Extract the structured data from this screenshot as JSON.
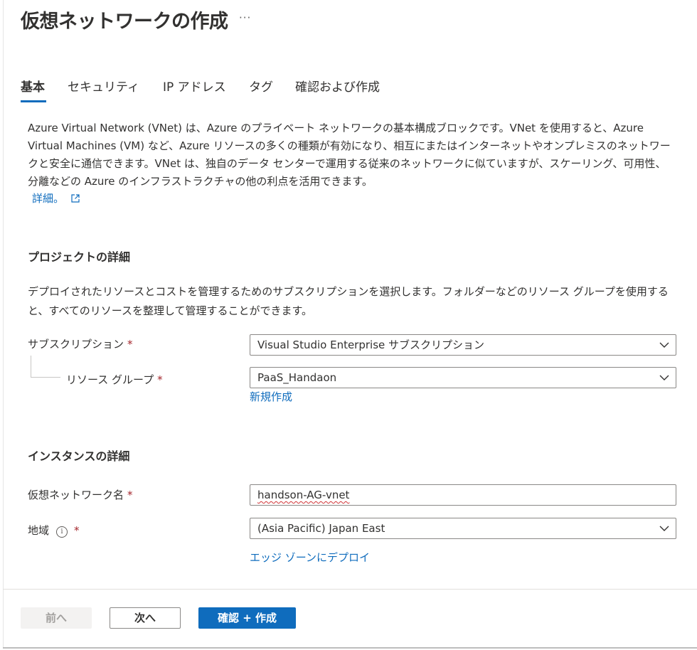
{
  "header": {
    "title": "仮想ネットワークの作成",
    "more_label": "···"
  },
  "tabs": [
    {
      "label": "基本",
      "active": true
    },
    {
      "label": "セキュリティ",
      "active": false
    },
    {
      "label": "IP アドレス",
      "active": false
    },
    {
      "label": "タグ",
      "active": false
    },
    {
      "label": "確認および作成",
      "active": false
    }
  ],
  "intro": {
    "text": "Azure Virtual Network (VNet) は、Azure のプライベート ネットワークの基本構成ブロックです。VNet を使用すると、Azure Virtual Machines (VM) など、Azure リソースの多くの種類が有効になり、相互にまたはインターネットやオンプレミスのネットワークと安全に通信できます。VNet は、独自のデータ センターで運用する従来のネットワークに似ていますが、スケーリング、可用性、分離などの Azure のインフラストラクチャの他の利点を活用できます。",
    "learn_more": "詳細。"
  },
  "project": {
    "title": "プロジェクトの詳細",
    "description": "デプロイされたリソースとコストを管理するためのサブスクリプションを選択します。フォルダーなどのリソース グループを使用すると、すべてのリソースを整理して管理することができます。",
    "subscription_label": "サブスクリプション",
    "subscription_value": "Visual Studio Enterprise サブスクリプション",
    "resource_group_label": "リソース グループ",
    "resource_group_value": "PaaS_Handaon",
    "create_new": "新規作成"
  },
  "instance": {
    "title": "インスタンスの詳細",
    "name_label": "仮想ネットワーク名",
    "name_value": "handson-AG-vnet",
    "region_label": "地域",
    "region_value": "(Asia Pacific) Japan East",
    "edge_zone_link": "エッジ ゾーンにデプロイ"
  },
  "required_mark": "*",
  "info_glyph": "i",
  "footer": {
    "prev": "前へ",
    "next": "次へ",
    "create": "確認 + 作成"
  },
  "colors": {
    "accent": "#0f6cbd",
    "required": "#a4262c",
    "disabled_bg": "#f3f2f1"
  }
}
